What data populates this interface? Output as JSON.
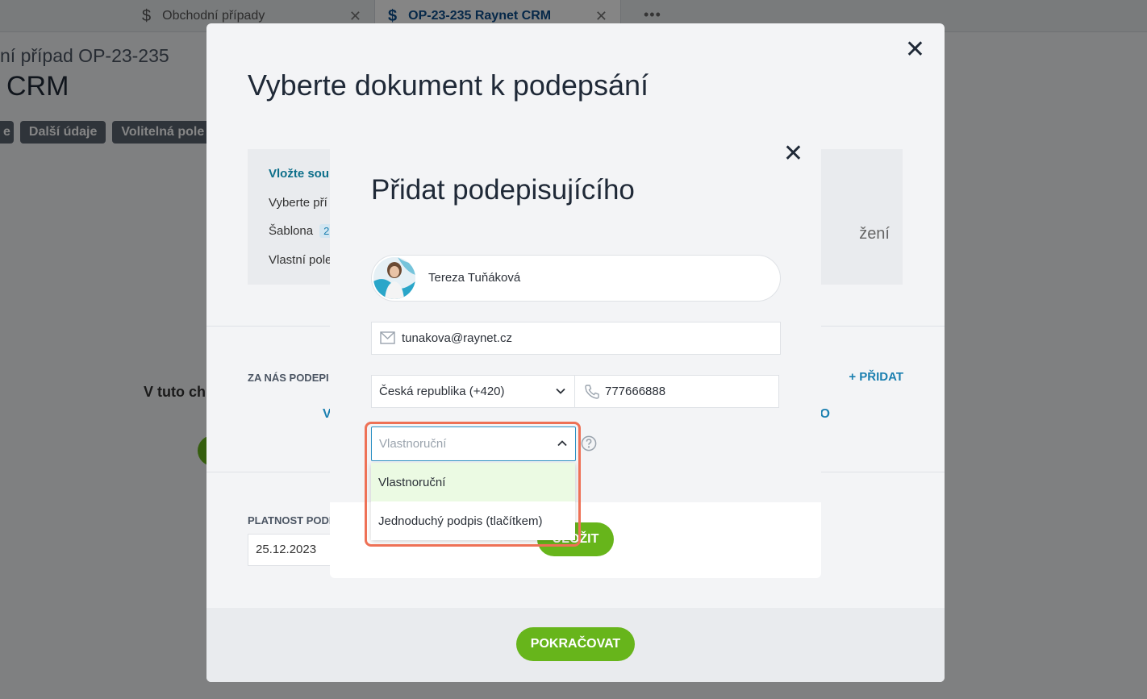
{
  "tabs": [
    {
      "label": "Obchodní případy",
      "icon": "dollar-icon"
    },
    {
      "label": "OP-23-235 Raynet CRM",
      "icon": "dollar-icon"
    }
  ],
  "tab_more": "•••",
  "page": {
    "subtitle": "ní případ OP-23-235",
    "title": "CRM",
    "chips": [
      "e",
      "Další údaje",
      "Volitelná pole"
    ],
    "left_text": "V tuto ch"
  },
  "modal_doc": {
    "title": "Vyberte dokument k podepsání",
    "side_items": [
      {
        "label": "Vložte soub",
        "active": true
      },
      {
        "label": "Vyberte pří"
      },
      {
        "label": "Šablona",
        "badge": "2"
      },
      {
        "label": "Vlastní pole"
      }
    ],
    "right_partial": "žení",
    "za_nas": "ZA NÁS PODEPI",
    "add_label": "+ PŘIDAT",
    "letter_left": "V",
    "letter_right": "O",
    "platnost_label": "PLATNOST PODP",
    "platnost_value": "25.12.2023",
    "continue_label": "POKRAČOVAT"
  },
  "modal_signer": {
    "title": "Přidat podepisujícího",
    "contact_name": "Tereza Tuňáková",
    "email": "tunakova@raynet.cz",
    "country": "Česká republika (+420)",
    "phone": "777666888",
    "signature_type_placeholder": "Vlastnoruční",
    "signature_options": [
      "Vlastnoruční",
      "Jednoduchý podpis (tlačítkem)"
    ],
    "save_label": "ULOŽIT"
  },
  "colors": {
    "accent_blue": "#1a7fb0",
    "green": "#67b51b",
    "highlight": "#ee7156"
  }
}
